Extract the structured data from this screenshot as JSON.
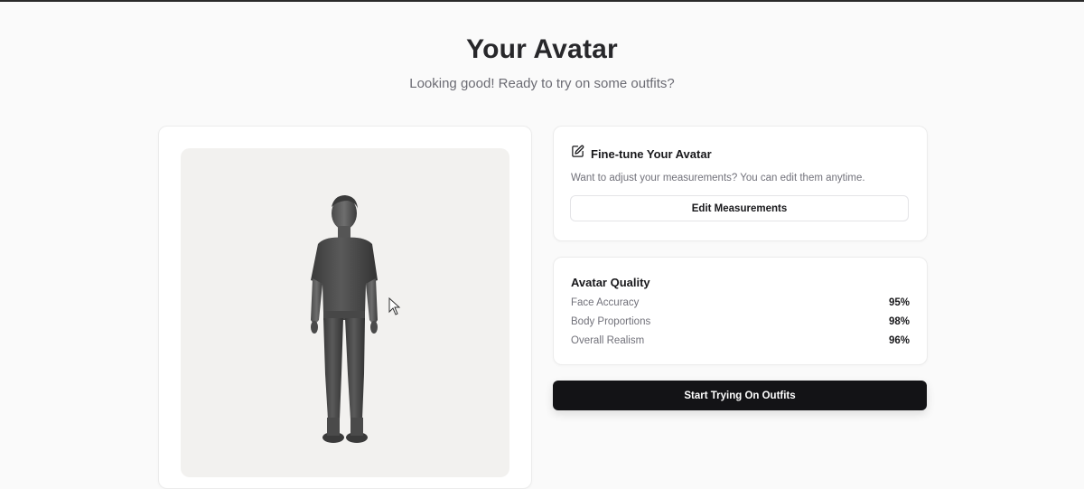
{
  "header": {
    "title": "Your Avatar",
    "subtitle": "Looking good! Ready to try on some outfits?"
  },
  "preview": {
    "avatar_icon": "3d-avatar-figure"
  },
  "finetune": {
    "icon": "edit-icon",
    "title": "Fine-tune Your Avatar",
    "description": "Want to adjust your measurements? You can edit them anytime.",
    "button_label": "Edit Measurements"
  },
  "quality": {
    "title": "Avatar Quality",
    "metrics": [
      {
        "label": "Face Accuracy",
        "value": "95%"
      },
      {
        "label": "Body Proportions",
        "value": "98%"
      },
      {
        "label": "Overall Realism",
        "value": "96%"
      }
    ]
  },
  "actions": {
    "start_label": "Start Trying On Outfits"
  },
  "colors": {
    "primary_button": "#131316",
    "background": "#fafafa",
    "avatar_bg": "#f2f1ef"
  }
}
